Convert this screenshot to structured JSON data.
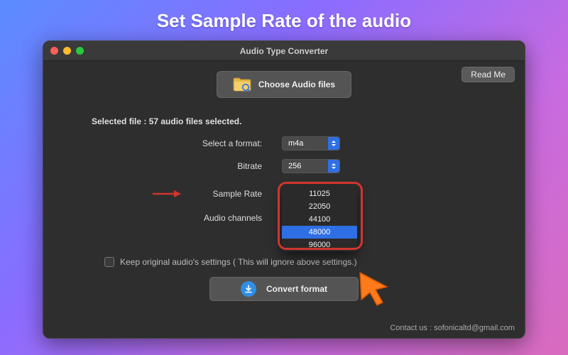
{
  "annotation_title": "Set Sample Rate of the audio",
  "window": {
    "title": "Audio Type Converter",
    "readme_label": "Read Me",
    "choose_label": "Choose Audio files",
    "selected_file": "Selected file : 57 audio files selected.",
    "format": {
      "label": "Select a format:",
      "value": "m4a"
    },
    "bitrate": {
      "label": "Bitrate",
      "value": "256"
    },
    "sample_rate": {
      "label": "Sample Rate",
      "options": [
        "11025",
        "22050",
        "44100",
        "48000",
        "96000"
      ],
      "selected": "48000"
    },
    "channels": {
      "label": "Audio channels"
    },
    "keep_original": "Keep original audio's settings ( This will ignore above settings.)",
    "convert_label": "Convert format",
    "contact": "Contact us : sofonicaltd@gmail.com"
  }
}
